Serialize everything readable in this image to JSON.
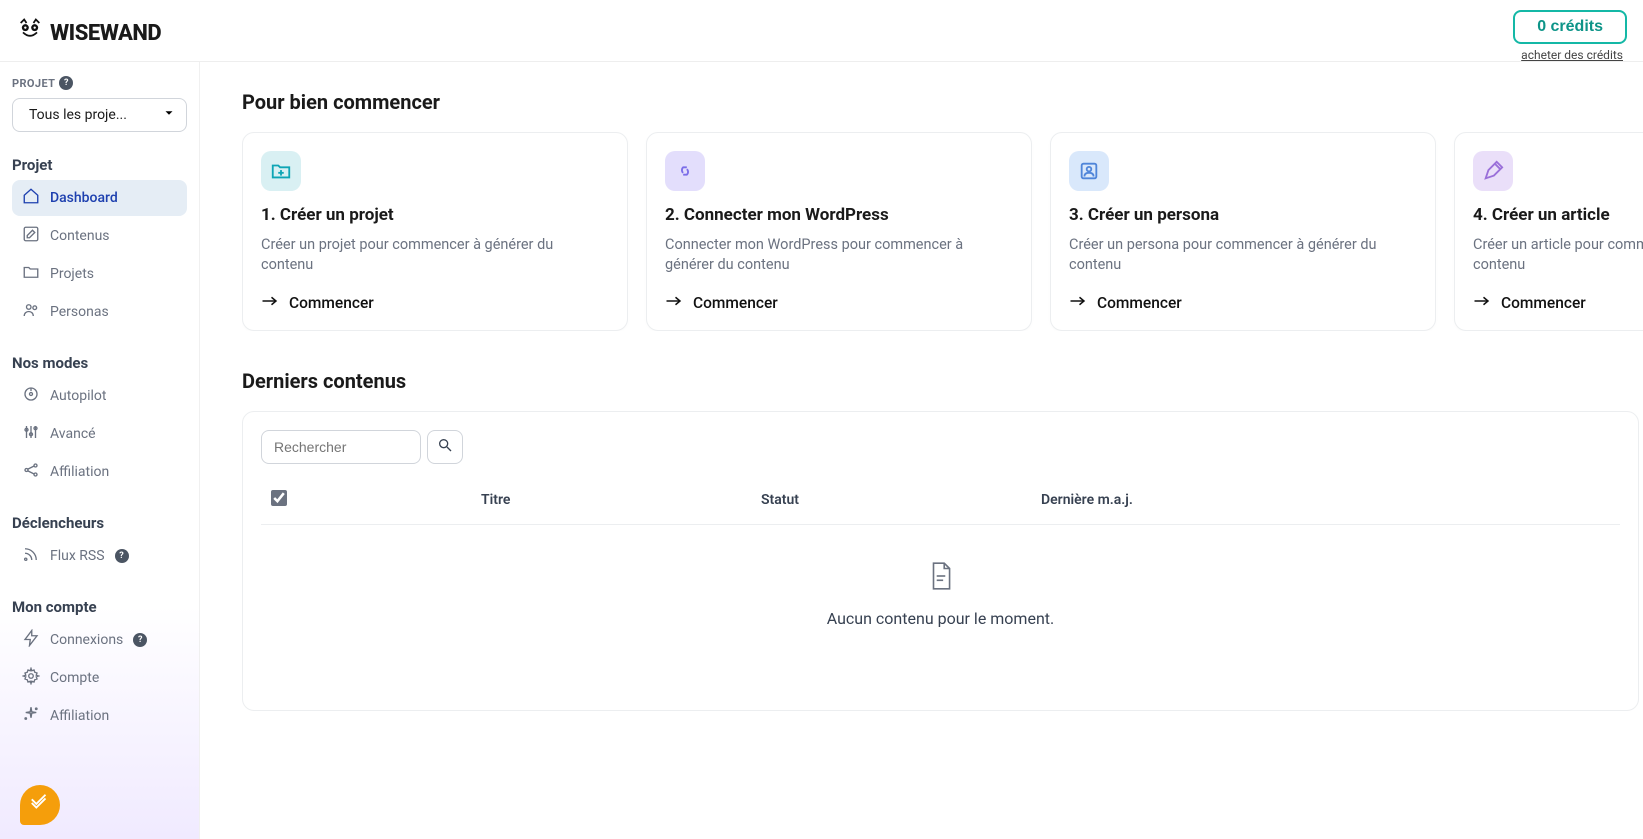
{
  "header": {
    "brand": "WISEWAND",
    "credits_label": "0 crédits",
    "buy_credits": "acheter des crédits"
  },
  "sidebar": {
    "project_label": "PROJET",
    "project_selector": "Tous les proje...",
    "sections": {
      "projet": {
        "title": "Projet",
        "items": [
          "Dashboard",
          "Contenus",
          "Projets",
          "Personas"
        ]
      },
      "modes": {
        "title": "Nos modes",
        "items": [
          "Autopilot",
          "Avancé",
          "Affiliation"
        ]
      },
      "triggers": {
        "title": "Déclencheurs",
        "items": [
          "Flux RSS"
        ]
      },
      "account": {
        "title": "Mon compte",
        "items": [
          "Connexions",
          "Compte",
          "Affiliation"
        ]
      }
    }
  },
  "onboarding": {
    "title": "Pour bien commencer",
    "cards": [
      {
        "title": "1. Créer un projet",
        "desc": "Créer un projet pour commencer à générer du contenu",
        "cta": "Commencer",
        "bg": "#d9f0f3",
        "fg": "#0ea5b5"
      },
      {
        "title": "2. Connecter mon WordPress",
        "desc": "Connecter mon WordPress pour commencer à générer du contenu",
        "cta": "Commencer",
        "bg": "#e3defc",
        "fg": "#7c6ee8"
      },
      {
        "title": "3. Créer un persona",
        "desc": "Créer un persona pour commencer à générer du contenu",
        "cta": "Commencer",
        "bg": "#d9e8fb",
        "fg": "#4f85d9"
      },
      {
        "title": "4. Créer un article",
        "desc": "Créer un article pour commencer à générer du contenu",
        "cta": "Commencer",
        "bg": "#eadff9",
        "fg": "#9a6fd9"
      }
    ]
  },
  "contents": {
    "title": "Derniers contenus",
    "search_placeholder": "Rechercher",
    "columns": {
      "title": "Titre",
      "status": "Statut",
      "date": "Dernière m.a.j."
    },
    "empty": "Aucun contenu pour le moment."
  }
}
